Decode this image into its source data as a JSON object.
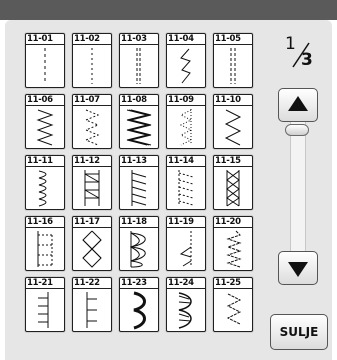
{
  "pager": {
    "current": "1",
    "total": "3"
  },
  "buttons": {
    "close_label": "SULJE"
  },
  "icons": {
    "scroll_up": "arrow-up-icon",
    "scroll_down": "arrow-down-icon"
  },
  "stitches": [
    {
      "code": "11-01",
      "icon": "straight-stitch-icon"
    },
    {
      "code": "11-02",
      "icon": "straight-stitch-icon"
    },
    {
      "code": "11-03",
      "icon": "triple-straight-stitch-icon"
    },
    {
      "code": "11-04",
      "icon": "lightning-stitch-icon"
    },
    {
      "code": "11-05",
      "icon": "double-straight-stitch-icon"
    },
    {
      "code": "11-06",
      "icon": "zigzag-stitch-icon"
    },
    {
      "code": "11-07",
      "icon": "dotted-zigzag-stitch-icon"
    },
    {
      "code": "11-08",
      "icon": "triple-zigzag-stitch-icon"
    },
    {
      "code": "11-09",
      "icon": "dotted-zigzag-stitch-icon"
    },
    {
      "code": "11-10",
      "icon": "wide-zigzag-stitch-icon"
    },
    {
      "code": "11-11",
      "icon": "scallop-stitch-icon"
    },
    {
      "code": "11-12",
      "icon": "ladder-stitch-icon"
    },
    {
      "code": "11-13",
      "icon": "slant-stitch-icon"
    },
    {
      "code": "11-14",
      "icon": "slant-dotted-stitch-icon"
    },
    {
      "code": "11-15",
      "icon": "cross-stitch-icon"
    },
    {
      "code": "11-16",
      "icon": "comb-stitch-icon"
    },
    {
      "code": "11-17",
      "icon": "diamond-stitch-icon"
    },
    {
      "code": "11-18",
      "icon": "honeycomb-stitch-icon"
    },
    {
      "code": "11-19",
      "icon": "blind-stitch-icon"
    },
    {
      "code": "11-20",
      "icon": "wave-stitch-icon"
    },
    {
      "code": "11-21",
      "icon": "comb-stitch-icon"
    },
    {
      "code": "11-22",
      "icon": "step-stitch-icon"
    },
    {
      "code": "11-23",
      "icon": "scallop-stitch-icon"
    },
    {
      "code": "11-24",
      "icon": "filled-scallop-stitch-icon"
    },
    {
      "code": "11-25",
      "icon": "zigzag-stitch-icon"
    }
  ]
}
